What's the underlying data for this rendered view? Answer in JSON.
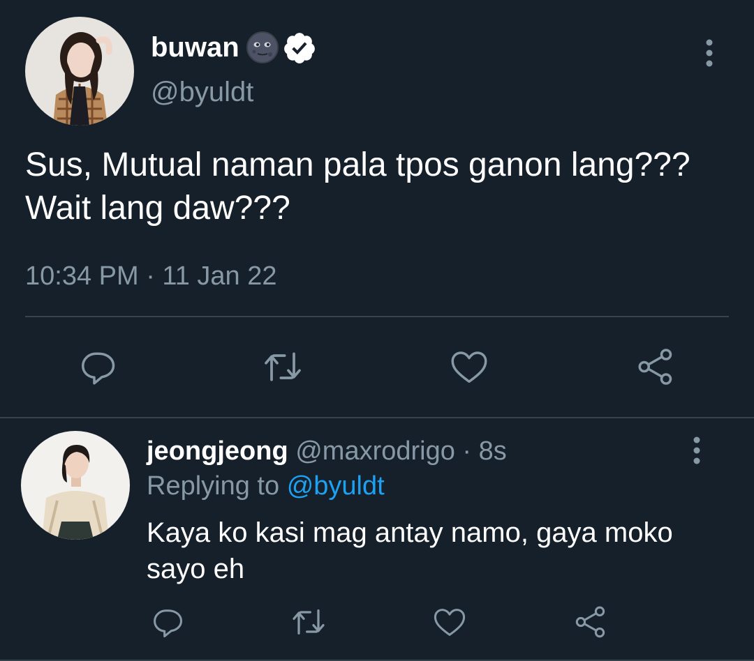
{
  "main_tweet": {
    "author_name": "buwan",
    "author_emoji": "🌚",
    "handle": "@byuldt",
    "text": "Sus, Mutual naman pala tpos ganon lang??? Wait lang daw???",
    "timestamp": "10:34 PM · 11 Jan 22",
    "verified": true,
    "icons": [
      "more-vertical-icon",
      "reply-icon",
      "retweet-icon",
      "like-icon",
      "share-icon"
    ]
  },
  "reply_tweet": {
    "author_name": "jeongjeong",
    "handle": "@maxrodrigo",
    "time_sep": " · ",
    "time_ago": "8s",
    "replying_label": "Replying to",
    "replying_handle": "@byuldt",
    "text": "Kaya ko kasi mag antay namo, gaya moko sayo eh"
  },
  "colors": {
    "background": "#15202b",
    "muted_text": "#8899a6",
    "link": "#1da1f2",
    "divider": "#38444d",
    "text": "#ffffff"
  }
}
